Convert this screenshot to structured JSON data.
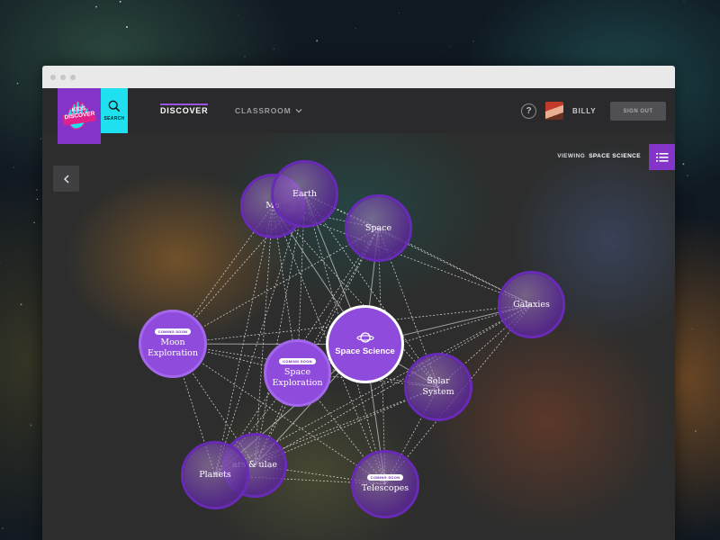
{
  "brand": {
    "logo_text": "KIDS DISCOVER",
    "colors": {
      "purple": "#8434c8",
      "cyan": "#1ee0ef",
      "nav": "#2a2a2c"
    }
  },
  "navbar": {
    "search_label": "SEARCH",
    "discover_label": "DISCOVER",
    "classroom_label": "CLASSROOM",
    "help_label": "?",
    "username": "BILLY",
    "signout_label": "SIGN OUT"
  },
  "viewing": {
    "label": "VIEWING",
    "value": "SPACE SCIENCE"
  },
  "nodes": [
    {
      "id": "moon",
      "label": "Mo",
      "style": "img"
    },
    {
      "id": "earth",
      "label": "Earth",
      "style": "img"
    },
    {
      "id": "space",
      "label": "Space",
      "style": "img"
    },
    {
      "id": "galaxies",
      "label": "Galaxies",
      "style": "img"
    },
    {
      "id": "moon-exploration",
      "label": "Moon Exploration",
      "style": "solid",
      "badge": "COMING SOON"
    },
    {
      "id": "space-exploration",
      "label": "Space Exploration",
      "style": "solid",
      "badge": "COMING SOON"
    },
    {
      "id": "space-science",
      "label": "Space Science",
      "style": "center",
      "icon": "planet-icon"
    },
    {
      "id": "solar-system",
      "label": "Solar System",
      "style": "img"
    },
    {
      "id": "stars-nebulae",
      "label": "ars & ulae",
      "style": "img"
    },
    {
      "id": "planets",
      "label": "Planets",
      "style": "img"
    },
    {
      "id": "telescopes",
      "label": "Telescopes",
      "style": "img",
      "badge": "COMING SOON"
    }
  ],
  "icons": {
    "search": "search-icon",
    "chevron": "chevron-down-icon",
    "back": "chevron-left-icon",
    "list": "list-icon",
    "center": "planet-icon"
  }
}
